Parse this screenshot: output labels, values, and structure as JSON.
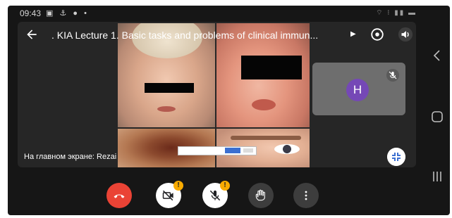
{
  "status_bar": {
    "time": "09:43",
    "left_icons": [
      "gallery-icon",
      "usb-icon",
      "bag-icon",
      "dot-icon"
    ],
    "right_icons": [
      "wifi-icon",
      "signal-icon",
      "battery-icon"
    ]
  },
  "meeting": {
    "title": ". KIA Lecture 1. Basic tasks and problems of clinical immun...",
    "presenter_label": "На главном экране: Rezai"
  },
  "self_tile": {
    "avatar_letter": "H",
    "avatar_color": "#7548b6"
  },
  "controls": [
    {
      "name": "end-call",
      "icon": "phone-hangup-icon",
      "color": "#ea4335"
    },
    {
      "name": "camera-toggle",
      "icon": "camera-off-icon",
      "warning": "!"
    },
    {
      "name": "mic-toggle",
      "icon": "mic-off-icon",
      "warning": "!"
    },
    {
      "name": "raise-hand",
      "icon": "hand-icon"
    },
    {
      "name": "more-options",
      "icon": "more-vert-icon"
    }
  ],
  "android_nav": [
    "back-icon",
    "home-icon",
    "recents-icon"
  ],
  "colors": {
    "background": "#161616",
    "meeting_surface": "#262626",
    "end_call": "#ea4335",
    "warning": "#f9ab00",
    "avatar": "#7548b6"
  }
}
